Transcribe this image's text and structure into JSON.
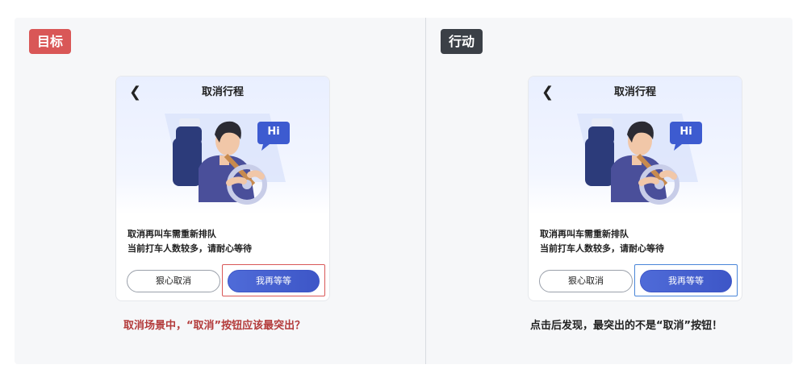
{
  "left_panel": {
    "tag": "目标",
    "card": {
      "title": "取消行程",
      "hi_bubble": "Hi",
      "message_line1": "取消再叫车需重新排队",
      "message_line2": "当前打车人数较多，请耐心等待",
      "cancel_button": "狠心取消",
      "wait_button": "我再等等"
    },
    "caption": "取消场景中，“取消”按钮应该最突出？"
  },
  "right_panel": {
    "tag": "行动",
    "card": {
      "title": "取消行程",
      "hi_bubble": "Hi",
      "message_line1": "取消再叫车需重新排队",
      "message_line2": "当前打车人数较多，请耐心等待",
      "cancel_button": "狠心取消",
      "wait_button": "我再等等"
    },
    "caption": "点击后发现，最突出的不是“取消”按钮！"
  },
  "colors": {
    "goal_tag": "#d95757",
    "action_tag": "#3b4047",
    "primary_button": "#4f6bd8",
    "goal_highlight": "#d95757",
    "action_highlight": "#4a86d8"
  }
}
